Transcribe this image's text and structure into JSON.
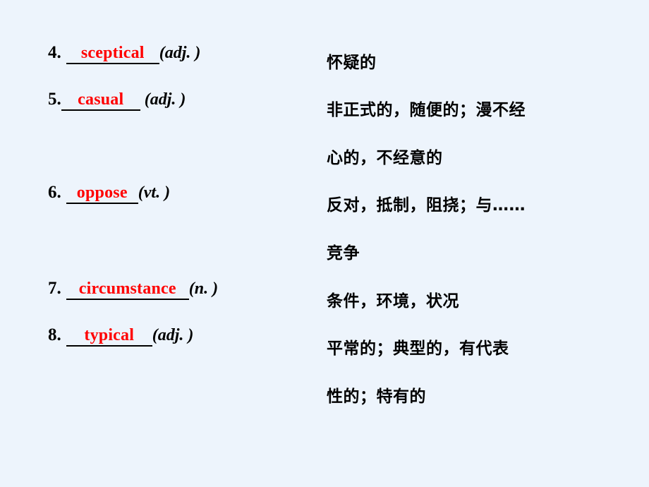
{
  "slide": {
    "background_color": "#edf4fc",
    "answer_color": "#ff0000",
    "text_color": "#000000"
  },
  "entries": [
    {
      "number": "4.",
      "answer": "sceptical",
      "pos": "(adj. )",
      "meaning_lines": [
        "怀疑的"
      ]
    },
    {
      "number": "5.",
      "answer": "casual",
      "pos": "(adj. )",
      "meaning_lines": [
        "非正式的，随便的；漫不经",
        "心的，不经意的"
      ]
    },
    {
      "number": "6.",
      "answer": "oppose",
      "pos": "(vt. )",
      "meaning_lines": [
        "反对，抵制，阻挠；与……",
        "竞争"
      ]
    },
    {
      "number": "7.",
      "answer": "circumstance",
      "pos": "(n. )",
      "meaning_lines": [
        "条件，环境，状况"
      ]
    },
    {
      "number": "8.",
      "answer": "typical",
      "pos": "(adj. )",
      "meaning_lines": [
        "平常的；典型的，有代表",
        "性的；特有的"
      ]
    }
  ],
  "meaning_flat_lines": [
    "怀疑的",
    "非正式的，随便的；漫不经",
    "心的，不经意的",
    "反对，抵制，阻挠；与……",
    "竞争",
    "条件，环境，状况",
    "平常的；典型的，有代表",
    "性的；特有的"
  ]
}
